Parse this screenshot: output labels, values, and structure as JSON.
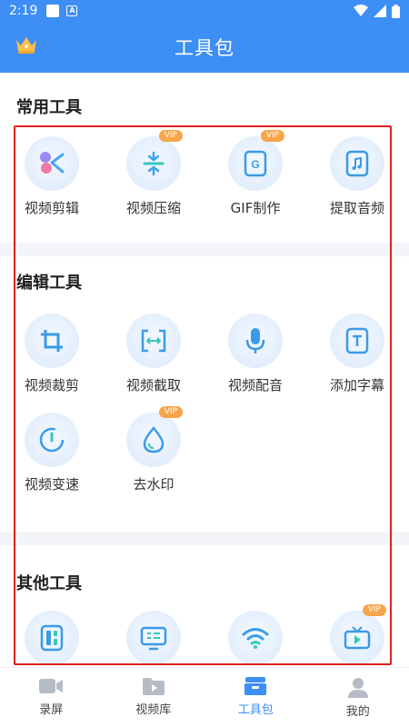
{
  "status_bar": {
    "time": "2:19"
  },
  "header": {
    "title": "工具包"
  },
  "sections": [
    {
      "title": "常用工具",
      "tools": [
        {
          "label": "视频剪辑",
          "icon": "scissors-icon",
          "vip": ""
        },
        {
          "label": "视频压缩",
          "icon": "compress-icon",
          "vip": "VIP"
        },
        {
          "label": "GIF制作",
          "icon": "gif-icon",
          "vip": "VIP"
        },
        {
          "label": "提取音频",
          "icon": "music-note-icon",
          "vip": ""
        }
      ]
    },
    {
      "title": "编辑工具",
      "tools": [
        {
          "label": "视频裁剪",
          "icon": "crop-icon",
          "vip": ""
        },
        {
          "label": "视频截取",
          "icon": "trim-icon",
          "vip": ""
        },
        {
          "label": "视频配音",
          "icon": "microphone-icon",
          "vip": ""
        },
        {
          "label": "添加字幕",
          "icon": "subtitle-icon",
          "vip": ""
        },
        {
          "label": "视频变速",
          "icon": "speed-icon",
          "vip": ""
        },
        {
          "label": "去水印",
          "icon": "watermark-drop-icon",
          "vip": "VIP"
        }
      ]
    },
    {
      "title": "其他工具",
      "tools": [
        {
          "label": "",
          "icon": "layout-icon",
          "vip": ""
        },
        {
          "label": "",
          "icon": "screen-icon",
          "vip": ""
        },
        {
          "label": "",
          "icon": "wifi-icon",
          "vip": ""
        },
        {
          "label": "",
          "icon": "tv-cast-icon",
          "vip": "VIP"
        }
      ]
    }
  ],
  "bottom_nav": [
    {
      "label": "录屏",
      "icon": "camera-icon",
      "active": false
    },
    {
      "label": "视频库",
      "icon": "video-folder-icon",
      "active": false
    },
    {
      "label": "工具包",
      "icon": "toolbox-icon",
      "active": true
    },
    {
      "label": "我的",
      "icon": "person-icon",
      "active": false
    }
  ],
  "colors": {
    "primary": "#3d8ef5",
    "vip_badge": "#f6a54a",
    "highlight": "#e0201f"
  }
}
